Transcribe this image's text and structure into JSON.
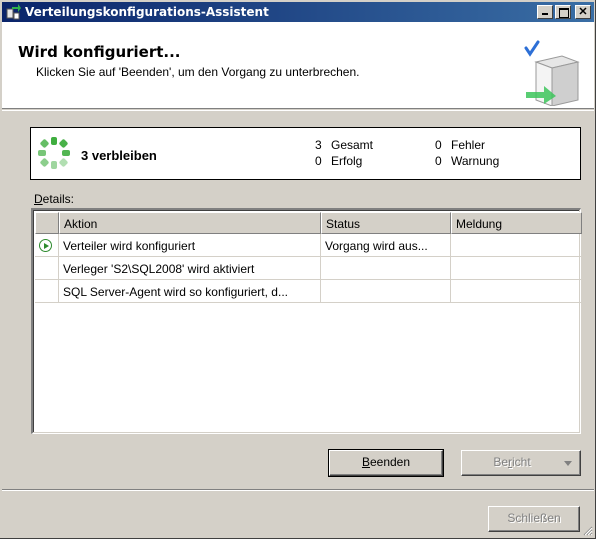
{
  "window": {
    "title": "Verteilungskonfigurations-Assistent"
  },
  "header": {
    "title": "Wird konfiguriert...",
    "subtitle": "Klicken Sie auf 'Beenden', um den Vorgang zu unterbrechen."
  },
  "progress": {
    "remaining_label": "3 verbleiben",
    "stats": {
      "total": {
        "value": "3",
        "label": "Gesamt"
      },
      "success": {
        "value": "0",
        "label": "Erfolg"
      },
      "errors": {
        "value": "0",
        "label": "Fehler"
      },
      "warnings": {
        "value": "0",
        "label": "Warnung"
      }
    }
  },
  "details": {
    "label_accel": "D",
    "label_rest": "etails:",
    "columns": [
      "",
      "Aktion",
      "Status",
      "Meldung"
    ],
    "rows": [
      {
        "icon": "running-icon",
        "action": "Verteiler wird konfiguriert",
        "status": "Vorgang wird aus...",
        "message": ""
      },
      {
        "icon": "",
        "action": "Verleger 'S2\\SQL2008' wird aktiviert",
        "status": "",
        "message": ""
      },
      {
        "icon": "",
        "action": "SQL Server-Agent wird so konfiguriert, d...",
        "status": "",
        "message": ""
      }
    ]
  },
  "buttons": {
    "stop_accel": "B",
    "stop_rest": "eenden",
    "report_pre": "Be",
    "report_accel": "r",
    "report_post": "icht",
    "close": "Schließen"
  }
}
